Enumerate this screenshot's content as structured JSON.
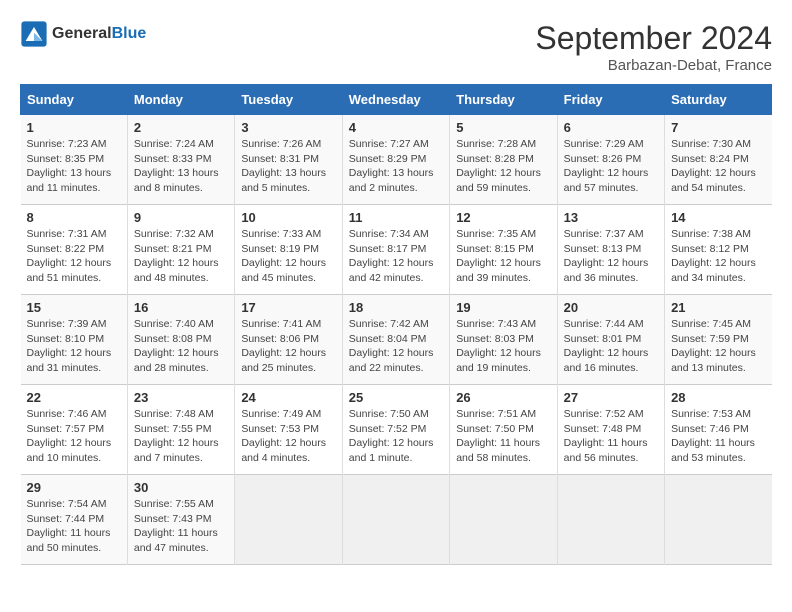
{
  "header": {
    "logo_general": "General",
    "logo_blue": "Blue",
    "month_title": "September 2024",
    "location": "Barbazan-Debat, France"
  },
  "columns": [
    "Sunday",
    "Monday",
    "Tuesday",
    "Wednesday",
    "Thursday",
    "Friday",
    "Saturday"
  ],
  "weeks": [
    [
      {
        "day": "1",
        "info": "Sunrise: 7:23 AM\nSunset: 8:35 PM\nDaylight: 13 hours\nand 11 minutes."
      },
      {
        "day": "2",
        "info": "Sunrise: 7:24 AM\nSunset: 8:33 PM\nDaylight: 13 hours\nand 8 minutes."
      },
      {
        "day": "3",
        "info": "Sunrise: 7:26 AM\nSunset: 8:31 PM\nDaylight: 13 hours\nand 5 minutes."
      },
      {
        "day": "4",
        "info": "Sunrise: 7:27 AM\nSunset: 8:29 PM\nDaylight: 13 hours\nand 2 minutes."
      },
      {
        "day": "5",
        "info": "Sunrise: 7:28 AM\nSunset: 8:28 PM\nDaylight: 12 hours\nand 59 minutes."
      },
      {
        "day": "6",
        "info": "Sunrise: 7:29 AM\nSunset: 8:26 PM\nDaylight: 12 hours\nand 57 minutes."
      },
      {
        "day": "7",
        "info": "Sunrise: 7:30 AM\nSunset: 8:24 PM\nDaylight: 12 hours\nand 54 minutes."
      }
    ],
    [
      {
        "day": "8",
        "info": "Sunrise: 7:31 AM\nSunset: 8:22 PM\nDaylight: 12 hours\nand 51 minutes."
      },
      {
        "day": "9",
        "info": "Sunrise: 7:32 AM\nSunset: 8:21 PM\nDaylight: 12 hours\nand 48 minutes."
      },
      {
        "day": "10",
        "info": "Sunrise: 7:33 AM\nSunset: 8:19 PM\nDaylight: 12 hours\nand 45 minutes."
      },
      {
        "day": "11",
        "info": "Sunrise: 7:34 AM\nSunset: 8:17 PM\nDaylight: 12 hours\nand 42 minutes."
      },
      {
        "day": "12",
        "info": "Sunrise: 7:35 AM\nSunset: 8:15 PM\nDaylight: 12 hours\nand 39 minutes."
      },
      {
        "day": "13",
        "info": "Sunrise: 7:37 AM\nSunset: 8:13 PM\nDaylight: 12 hours\nand 36 minutes."
      },
      {
        "day": "14",
        "info": "Sunrise: 7:38 AM\nSunset: 8:12 PM\nDaylight: 12 hours\nand 34 minutes."
      }
    ],
    [
      {
        "day": "15",
        "info": "Sunrise: 7:39 AM\nSunset: 8:10 PM\nDaylight: 12 hours\nand 31 minutes."
      },
      {
        "day": "16",
        "info": "Sunrise: 7:40 AM\nSunset: 8:08 PM\nDaylight: 12 hours\nand 28 minutes."
      },
      {
        "day": "17",
        "info": "Sunrise: 7:41 AM\nSunset: 8:06 PM\nDaylight: 12 hours\nand 25 minutes."
      },
      {
        "day": "18",
        "info": "Sunrise: 7:42 AM\nSunset: 8:04 PM\nDaylight: 12 hours\nand 22 minutes."
      },
      {
        "day": "19",
        "info": "Sunrise: 7:43 AM\nSunset: 8:03 PM\nDaylight: 12 hours\nand 19 minutes."
      },
      {
        "day": "20",
        "info": "Sunrise: 7:44 AM\nSunset: 8:01 PM\nDaylight: 12 hours\nand 16 minutes."
      },
      {
        "day": "21",
        "info": "Sunrise: 7:45 AM\nSunset: 7:59 PM\nDaylight: 12 hours\nand 13 minutes."
      }
    ],
    [
      {
        "day": "22",
        "info": "Sunrise: 7:46 AM\nSunset: 7:57 PM\nDaylight: 12 hours\nand 10 minutes."
      },
      {
        "day": "23",
        "info": "Sunrise: 7:48 AM\nSunset: 7:55 PM\nDaylight: 12 hours\nand 7 minutes."
      },
      {
        "day": "24",
        "info": "Sunrise: 7:49 AM\nSunset: 7:53 PM\nDaylight: 12 hours\nand 4 minutes."
      },
      {
        "day": "25",
        "info": "Sunrise: 7:50 AM\nSunset: 7:52 PM\nDaylight: 12 hours\nand 1 minute."
      },
      {
        "day": "26",
        "info": "Sunrise: 7:51 AM\nSunset: 7:50 PM\nDaylight: 11 hours\nand 58 minutes."
      },
      {
        "day": "27",
        "info": "Sunrise: 7:52 AM\nSunset: 7:48 PM\nDaylight: 11 hours\nand 56 minutes."
      },
      {
        "day": "28",
        "info": "Sunrise: 7:53 AM\nSunset: 7:46 PM\nDaylight: 11 hours\nand 53 minutes."
      }
    ],
    [
      {
        "day": "29",
        "info": "Sunrise: 7:54 AM\nSunset: 7:44 PM\nDaylight: 11 hours\nand 50 minutes."
      },
      {
        "day": "30",
        "info": "Sunrise: 7:55 AM\nSunset: 7:43 PM\nDaylight: 11 hours\nand 47 minutes."
      },
      null,
      null,
      null,
      null,
      null
    ]
  ]
}
